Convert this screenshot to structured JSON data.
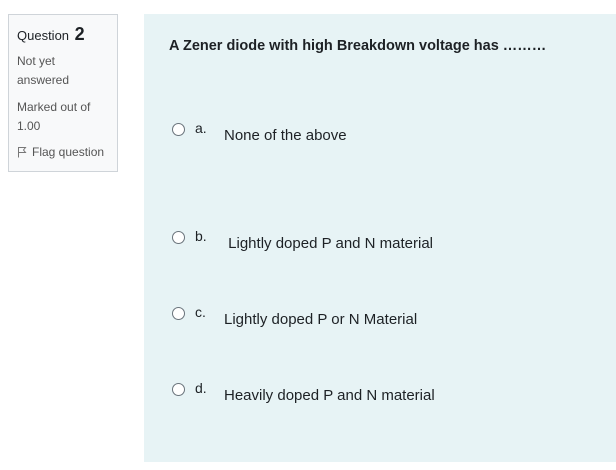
{
  "info": {
    "question_label": "Question",
    "question_number": "2",
    "state": "Not yet answered",
    "grade": "Marked out of 1.00",
    "flag_label": "Flag question"
  },
  "question": {
    "text": "A Zener diode with high Breakdown voltage has ………",
    "options": [
      {
        "letter": "a.",
        "text": "None of the above"
      },
      {
        "letter": "b.",
        "text": " Lightly doped P and N material"
      },
      {
        "letter": "c.",
        "text": "Lightly doped P or N Material"
      },
      {
        "letter": "d.",
        "text": "Heavily doped P and N material"
      }
    ]
  }
}
